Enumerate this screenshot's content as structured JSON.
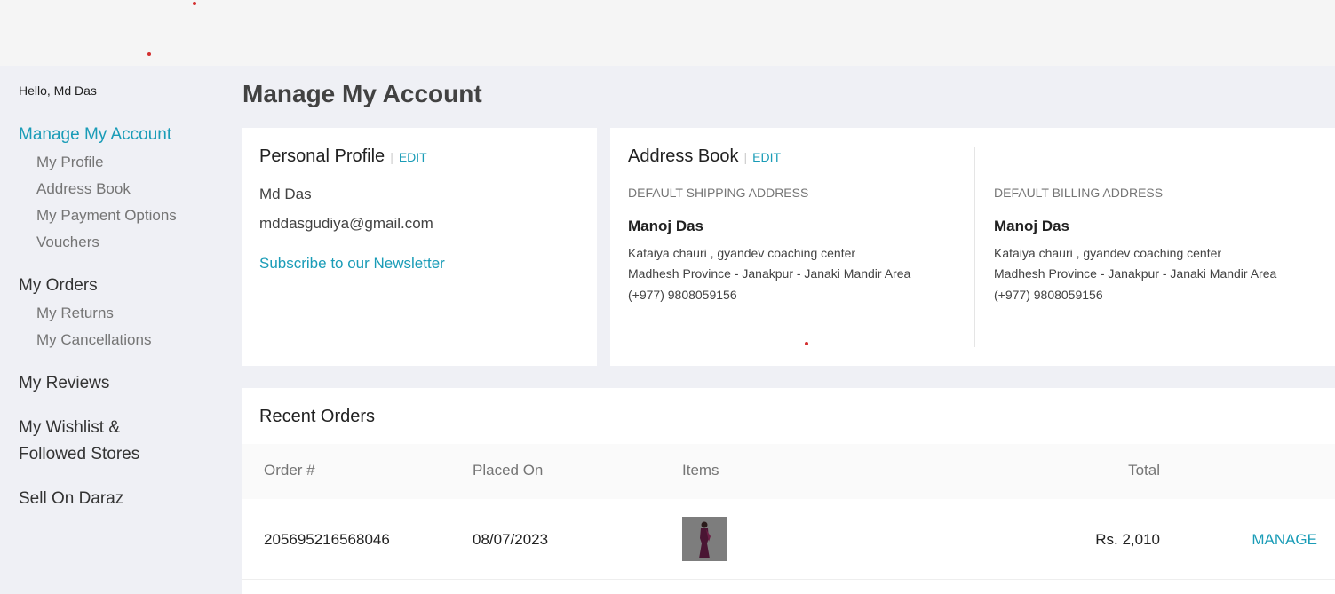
{
  "sidebar": {
    "greeting": "Hello, Md Das",
    "manage_account": "Manage My Account",
    "my_profile": "My Profile",
    "address_book": "Address Book",
    "payment_options": "My Payment Options",
    "vouchers": "Vouchers",
    "my_orders": "My Orders",
    "my_returns": "My Returns",
    "my_cancellations": "My Cancellations",
    "my_reviews": "My Reviews",
    "wishlist_line1": "My Wishlist &",
    "wishlist_line2": "Followed Stores",
    "sell": "Sell On Daraz"
  },
  "page": {
    "title": "Manage My Account"
  },
  "profile": {
    "title": "Personal Profile",
    "separator": "|",
    "edit": "EDIT",
    "name": "Md Das",
    "email": "mddasgudiya@gmail.com",
    "newsletter": "Subscribe to our Newsletter"
  },
  "address_book": {
    "title": "Address Book",
    "separator": "|",
    "edit": "EDIT",
    "shipping": {
      "heading": "DEFAULT SHIPPING ADDRESS",
      "name": "Manoj Das",
      "line1": "Kataiya chauri , gyandev coaching center",
      "line2": "Madhesh Province - Janakpur - Janaki Mandir Area",
      "phone": "(+977) 9808059156"
    },
    "billing": {
      "heading": "DEFAULT BILLING ADDRESS",
      "name": "Manoj Das",
      "line1": "Kataiya chauri , gyandev coaching center",
      "line2": "Madhesh Province - Janakpur - Janaki Mandir Area",
      "phone": "(+977) 9808059156"
    }
  },
  "orders": {
    "title": "Recent Orders",
    "headers": {
      "order": "Order #",
      "placed": "Placed On",
      "items": "Items",
      "total": "Total"
    },
    "rows": [
      {
        "order": "205695216568046",
        "placed": "08/07/2023",
        "item_icon": "saree-product-thumbnail",
        "total": "Rs. 2,010",
        "action": "MANAGE"
      }
    ]
  },
  "colors": {
    "accent": "#1a9cb7",
    "background": "#eff0f5",
    "card": "#ffffff",
    "marker": "#d32f2f"
  }
}
